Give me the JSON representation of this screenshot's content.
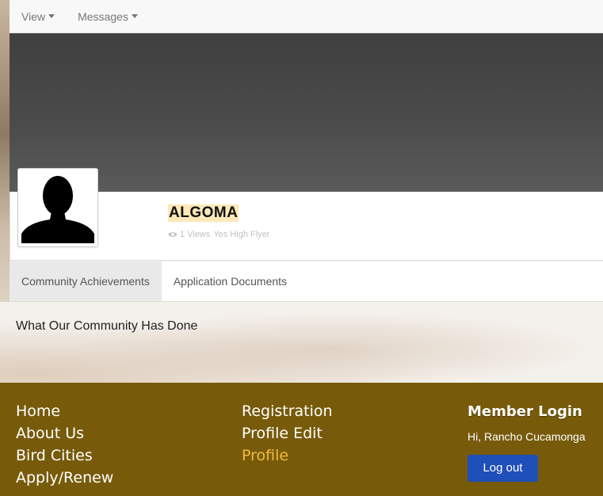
{
  "nav": {
    "items": [
      {
        "label": "View"
      },
      {
        "label": "Messages"
      }
    ]
  },
  "profile": {
    "name": "ALGOMA",
    "views": "1 Views",
    "badge": "Yes High Flyer"
  },
  "tabs": [
    {
      "label": "Community Achievements",
      "active": true
    },
    {
      "label": "Application Documents",
      "active": false
    }
  ],
  "content": {
    "text": "What Our Community Has Done"
  },
  "footer": {
    "col1": [
      "Home",
      "About Us",
      "Bird Cities",
      "Apply/Renew"
    ],
    "col2": [
      "Registration",
      "Profile Edit",
      "Profile"
    ],
    "login": {
      "title": "Member Login",
      "greeting": "Hi, Rancho Cucamonga",
      "logout": "Log out"
    }
  },
  "colors": {
    "footer_bg": "#775b0b",
    "active_link": "#f4b93c",
    "button": "#1f4fb8"
  }
}
